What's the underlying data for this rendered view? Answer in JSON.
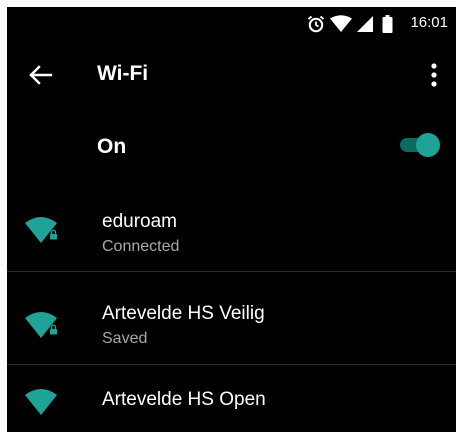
{
  "status_bar": {
    "time": "16:01",
    "icons": [
      "alarm-icon",
      "wifi-signal-icon",
      "cell-signal-icon",
      "battery-icon"
    ]
  },
  "app_bar": {
    "title": "Wi-Fi",
    "back_icon": "arrow-back-icon",
    "menu_icon": "more-vert-icon"
  },
  "master_switch": {
    "label": "On",
    "state": "on"
  },
  "networks": [
    {
      "name": "eduroam",
      "status": "Connected",
      "secured": true,
      "icon": "wifi-lock-icon"
    },
    {
      "name": "Artevelde HS Veilig",
      "status": "Saved",
      "secured": true,
      "icon": "wifi-lock-icon"
    },
    {
      "name": "Artevelde HS Open",
      "status": "",
      "secured": false,
      "icon": "wifi-icon"
    }
  ],
  "colors": {
    "background": "#000000",
    "accent": "#1ea396",
    "accent_track": "#0e6a60",
    "secondary_text": "#a8a8a8",
    "divider": "#2c2c2c"
  }
}
